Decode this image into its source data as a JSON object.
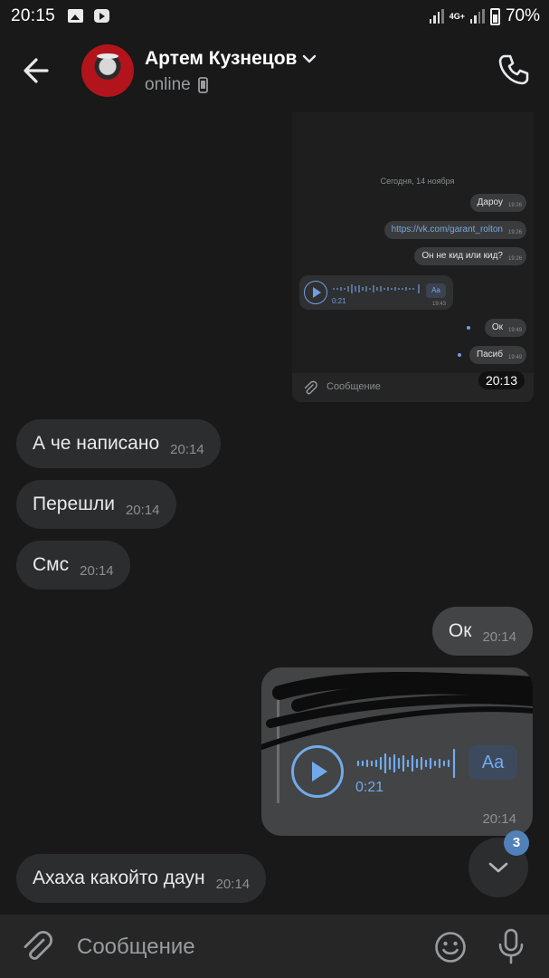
{
  "status_bar": {
    "time": "20:15",
    "network": "4G+",
    "battery": "70%"
  },
  "header": {
    "contact_name": "Артем Кузнецов",
    "status": "online"
  },
  "embedded": {
    "date": "Сегодня, 14 ноября",
    "messages": [
      {
        "text": "Дароу",
        "time": "19:26"
      },
      {
        "text": "https://vk.com/garant_rolton",
        "time": "19:26"
      },
      {
        "text": "Он не кид или кид?",
        "time": "19:26"
      },
      {
        "text": "Ок",
        "time": "19:49"
      },
      {
        "text": "Пасиб",
        "time": "19:49"
      }
    ],
    "voice": {
      "duration": "0:21",
      "transcribe_label": "Aa",
      "time": "19:43"
    },
    "input_placeholder": "Сообщение",
    "timestamp_overlay": "20:13"
  },
  "messages": [
    {
      "text": "А че написано",
      "time": "20:14",
      "direction": "in"
    },
    {
      "text": "Перешли",
      "time": "20:14",
      "direction": "in"
    },
    {
      "text": "Смс",
      "time": "20:14",
      "direction": "in"
    },
    {
      "text": "Ок",
      "time": "20:14",
      "direction": "out"
    },
    {
      "text": "Ахаха какойто даун",
      "time": "20:14",
      "direction": "in"
    }
  ],
  "forwarded_voice": {
    "duration": "0:21",
    "transcribe_label": "Aa",
    "time": "20:14"
  },
  "scroll_down": {
    "unread_count": "3"
  },
  "composer": {
    "placeholder": "Сообщение"
  },
  "colors": {
    "accent": "#71aaeb",
    "badge": "#5181b8",
    "bubble_in": "#2c2d2e",
    "bubble_out": "#434445",
    "background": "#19191a"
  }
}
